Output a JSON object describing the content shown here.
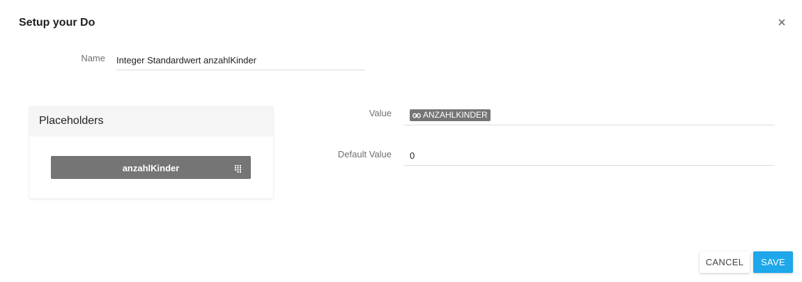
{
  "dialog": {
    "title": "Setup your Do"
  },
  "name_field": {
    "label": "Name",
    "value": "Integer Standardwert anzahlKinder"
  },
  "placeholders": {
    "title": "Placeholders",
    "items": [
      {
        "label": "anzahlKinder",
        "icon": "drag-handle-icon"
      }
    ]
  },
  "value_field": {
    "label": "Value",
    "chip_label": "ANZAHLKINDER",
    "chip_icon": "link-icon"
  },
  "default_value_field": {
    "label": "Default Value",
    "value": "0"
  },
  "buttons": {
    "cancel": "CANCEL",
    "save": "SAVE"
  },
  "colors": {
    "accent": "#1ea7ea",
    "chip": "#757575"
  }
}
